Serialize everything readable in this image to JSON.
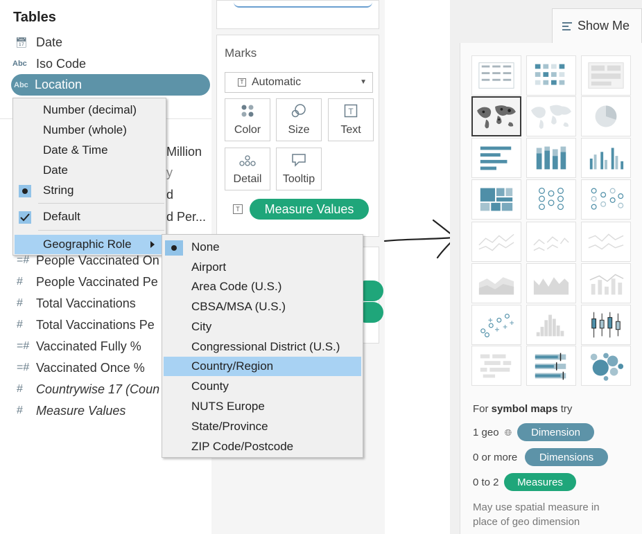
{
  "data_pane": {
    "title": "Tables",
    "fields_top": [
      {
        "type": "calendar-icon",
        "type_label": "",
        "label": "Date"
      },
      {
        "type": "abc",
        "type_label": "Abc",
        "label": "Iso Code"
      },
      {
        "type": "abc",
        "type_label": "Abc",
        "label": "Location"
      }
    ],
    "partially_hidden": [
      "Million",
      "y",
      "d",
      "d Per..."
    ],
    "fields_bottom": [
      {
        "type_label": "=#",
        "label": "People Vaccinated On"
      },
      {
        "type_label": "#",
        "label": "People Vaccinated Pe"
      },
      {
        "type_label": "#",
        "label": "Total Vaccinations"
      },
      {
        "type_label": "#",
        "label": "Total Vaccinations Pe"
      },
      {
        "type_label": "=#",
        "label": "Vaccinated Fully %"
      },
      {
        "type_label": "=#",
        "label": "Vaccinated Once %"
      },
      {
        "type_label": "#",
        "label": "Countrywise 17 (Coun"
      },
      {
        "type_label": "#",
        "label": "Measure Values"
      }
    ]
  },
  "context_menu": {
    "items": [
      {
        "label": "Number (decimal)"
      },
      {
        "label": "Number (whole)"
      },
      {
        "label": "Date & Time"
      },
      {
        "label": "Date"
      },
      {
        "label": "String",
        "mark": "●"
      },
      {
        "label": "Default",
        "mark": "✓"
      },
      {
        "label": "Geographic Role",
        "submenu": true
      }
    ]
  },
  "submenu": {
    "items": [
      {
        "label": "None",
        "mark": "●"
      },
      {
        "label": "Airport"
      },
      {
        "label": "Area Code (U.S.)"
      },
      {
        "label": "CBSA/MSA (U.S.)"
      },
      {
        "label": "City"
      },
      {
        "label": "Congressional District (U.S.)"
      },
      {
        "label": "Country/Region",
        "highlighted": true
      },
      {
        "label": "County"
      },
      {
        "label": "NUTS Europe"
      },
      {
        "label": "State/Province"
      },
      {
        "label": "ZIP Code/Postcode"
      }
    ]
  },
  "marks_card": {
    "title": "Marks",
    "mark_type": "Automatic",
    "buttons": [
      {
        "label": "Color",
        "icon": "color-dots-icon"
      },
      {
        "label": "Size",
        "icon": "size-circles-icon"
      },
      {
        "label": "Text",
        "icon": "text-box-icon"
      },
      {
        "label": "Detail",
        "icon": "detail-dots-icon"
      },
      {
        "label": "Tooltip",
        "icon": "tooltip-bubble-icon"
      }
    ],
    "pill": "Measure Values"
  },
  "show_me": {
    "tab_label": "Show Me",
    "hint_title_prefix": "For",
    "hint_title_bold": "symbol maps",
    "hint_title_suffix": "try",
    "requirements": [
      {
        "count": "1 geo",
        "pill": "Dimension"
      },
      {
        "count": "0 or more",
        "pill": "Dimensions"
      },
      {
        "count": "0 to 2",
        "pill": "Measures"
      }
    ],
    "note": "May use spatial measure in place of geo dimension"
  },
  "colors": {
    "accent_blue": "#5d93a8",
    "accent_green": "#1fa67a",
    "menu_highlight": "#a8d2f3"
  }
}
